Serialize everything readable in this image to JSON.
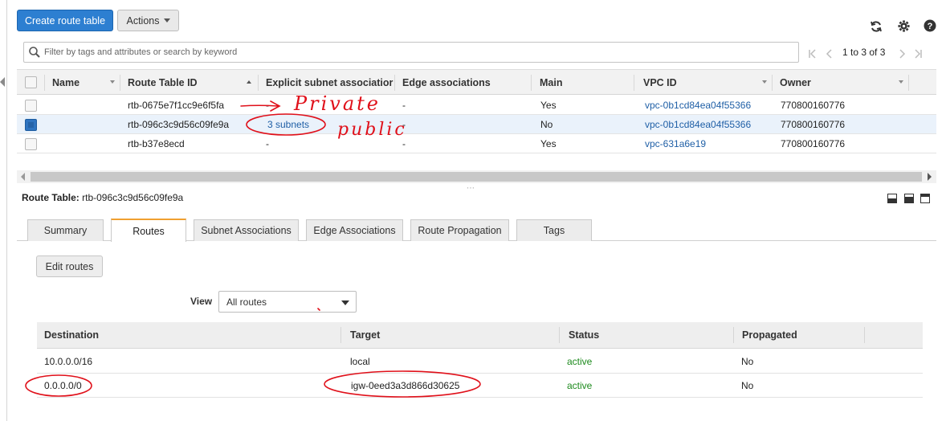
{
  "toolbar": {
    "create_label": "Create route table",
    "actions_label": "Actions"
  },
  "icons": [
    "refresh-icon",
    "gear-icon",
    "help-icon",
    "search-icon"
  ],
  "search": {
    "placeholder": "Filter by tags and attributes or search by keyword"
  },
  "pager": {
    "text": "1 to 3 of 3"
  },
  "table": {
    "columns": [
      "Name",
      "Route Table ID",
      "Explicit subnet associatior",
      "Edge associations",
      "Main",
      "VPC ID",
      "Owner"
    ],
    "rows": [
      {
        "name": "",
        "id": "rtb-0675e7f1cc9e6f5fa",
        "subnet": "-",
        "edge": "-",
        "main": "Yes",
        "vpc": "vpc-0b1cd84ea04f55366",
        "owner": "770800160776",
        "selected": false
      },
      {
        "name": "",
        "id": "rtb-096c3c9d56c09fe9a",
        "subnet": "3 subnets",
        "edge": "-",
        "main": "No",
        "vpc": "vpc-0b1cd84ea04f55366",
        "owner": "770800160776",
        "selected": true
      },
      {
        "name": "",
        "id": "rtb-b37e8ecd",
        "subnet": "-",
        "edge": "-",
        "main": "Yes",
        "vpc": "vpc-631a6e19",
        "owner": "770800160776",
        "selected": false
      }
    ]
  },
  "annotations": {
    "private": "Private",
    "public": "public"
  },
  "detail": {
    "label": "Route Table:",
    "id": "rtb-096c3c9d56c09fe9a",
    "tabs": [
      "Summary",
      "Routes",
      "Subnet Associations",
      "Edge Associations",
      "Route Propagation",
      "Tags"
    ],
    "active_tab": "Routes",
    "edit_label": "Edit routes",
    "view_label": "View",
    "view_value": "All routes"
  },
  "routes": {
    "columns": [
      "Destination",
      "Target",
      "Status",
      "Propagated"
    ],
    "rows": [
      {
        "destination": "10.0.0.0/16",
        "target": "local",
        "status": "active",
        "propagated": "No"
      },
      {
        "destination": "0.0.0.0/0",
        "target": "igw-0eed3a3d866d30625",
        "status": "active",
        "propagated": "No"
      }
    ]
  },
  "colors": {
    "primary_button": "#2d7fd1",
    "link": "#1f5fa6",
    "active_status": "#1d8a1d",
    "active_tab_accent": "#f0a030",
    "annotation_ink": "#e0101a"
  }
}
